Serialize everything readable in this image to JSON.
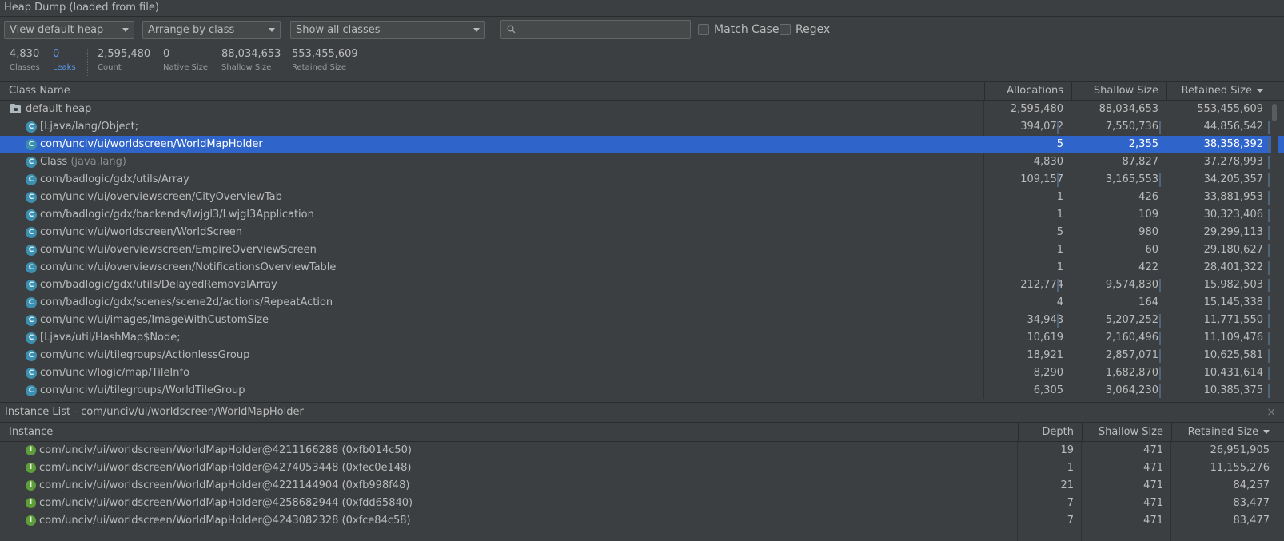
{
  "title": "Heap Dump (loaded from file)",
  "toolbar": {
    "heap_select": "View default heap",
    "arrange_select": "Arrange by class",
    "filter_select": "Show all classes",
    "search_value": "",
    "match_case_label": "Match Case",
    "regex_label": "Regex"
  },
  "stats": [
    {
      "value": "4,830",
      "label": "Classes"
    },
    {
      "value": "0",
      "label": "Leaks"
    },
    {
      "value": "2,595,480",
      "label": "Count"
    },
    {
      "value": "0",
      "label": "Native Size"
    },
    {
      "value": "88,034,653",
      "label": "Shallow Size"
    },
    {
      "value": "553,455,609",
      "label": "Retained Size"
    }
  ],
  "class_table": {
    "columns": [
      "Class Name",
      "Allocations",
      "Shallow Size",
      "Retained Size"
    ],
    "root": {
      "name": "default heap",
      "allocations": "2,595,480",
      "shallow": "88,034,653",
      "retained": "553,455,609"
    },
    "rows": [
      {
        "name": "[Ljava/lang/Object;",
        "suffix": "",
        "allocations": "394,072",
        "shallow": "7,550,736",
        "retained": "44,856,542"
      },
      {
        "name": "com/unciv/ui/worldscreen/WorldMapHolder",
        "suffix": "",
        "allocations": "5",
        "shallow": "2,355",
        "retained": "38,358,392"
      },
      {
        "name": "Class",
        "suffix": "(java.lang)",
        "allocations": "4,830",
        "shallow": "87,827",
        "retained": "37,278,993"
      },
      {
        "name": "com/badlogic/gdx/utils/Array",
        "suffix": "",
        "allocations": "109,157",
        "shallow": "3,165,553",
        "retained": "34,205,357"
      },
      {
        "name": "com/unciv/ui/overviewscreen/CityOverviewTab",
        "suffix": "",
        "allocations": "1",
        "shallow": "426",
        "retained": "33,881,953"
      },
      {
        "name": "com/badlogic/gdx/backends/lwjgl3/Lwjgl3Application",
        "suffix": "",
        "allocations": "1",
        "shallow": "109",
        "retained": "30,323,406"
      },
      {
        "name": "com/unciv/ui/worldscreen/WorldScreen",
        "suffix": "",
        "allocations": "5",
        "shallow": "980",
        "retained": "29,299,113"
      },
      {
        "name": "com/unciv/ui/overviewscreen/EmpireOverviewScreen",
        "suffix": "",
        "allocations": "1",
        "shallow": "60",
        "retained": "29,180,627"
      },
      {
        "name": "com/unciv/ui/overviewscreen/NotificationsOverviewTable",
        "suffix": "",
        "allocations": "1",
        "shallow": "422",
        "retained": "28,401,322"
      },
      {
        "name": "com/badlogic/gdx/utils/DelayedRemovalArray",
        "suffix": "",
        "allocations": "212,774",
        "shallow": "9,574,830",
        "retained": "15,982,503"
      },
      {
        "name": "com/badlogic/gdx/scenes/scene2d/actions/RepeatAction",
        "suffix": "",
        "allocations": "4",
        "shallow": "164",
        "retained": "15,145,338"
      },
      {
        "name": "com/unciv/ui/images/ImageWithCustomSize",
        "suffix": "",
        "allocations": "34,948",
        "shallow": "5,207,252",
        "retained": "11,771,550"
      },
      {
        "name": "[Ljava/util/HashMap$Node;",
        "suffix": "",
        "allocations": "10,619",
        "shallow": "2,160,496",
        "retained": "11,109,476"
      },
      {
        "name": "com/unciv/ui/tilegroups/ActionlessGroup",
        "suffix": "",
        "allocations": "18,921",
        "shallow": "2,857,071",
        "retained": "10,625,581"
      },
      {
        "name": "com/unciv/logic/map/TileInfo",
        "suffix": "",
        "allocations": "8,290",
        "shallow": "1,682,870",
        "retained": "10,431,614"
      },
      {
        "name": "com/unciv/ui/tilegroups/WorldTileGroup",
        "suffix": "",
        "allocations": "6,305",
        "shallow": "3,064,230",
        "retained": "10,385,375"
      }
    ],
    "selected_index": 1
  },
  "instance_panel": {
    "title": "Instance List - com/unciv/ui/worldscreen/WorldMapHolder",
    "columns": [
      "Instance",
      "Depth",
      "Shallow Size",
      "Retained Size"
    ],
    "rows": [
      {
        "name": "com/unciv/ui/worldscreen/WorldMapHolder@4211166288 (0xfb014c50)",
        "depth": "19",
        "shallow": "471",
        "retained": "26,951,905"
      },
      {
        "name": "com/unciv/ui/worldscreen/WorldMapHolder@4274053448 (0xfec0e148)",
        "depth": "1",
        "shallow": "471",
        "retained": "11,155,276"
      },
      {
        "name": "com/unciv/ui/worldscreen/WorldMapHolder@4221144904 (0xfb998f48)",
        "depth": "21",
        "shallow": "471",
        "retained": "84,257"
      },
      {
        "name": "com/unciv/ui/worldscreen/WorldMapHolder@4258682944 (0xfdd65840)",
        "depth": "7",
        "shallow": "471",
        "retained": "83,477"
      },
      {
        "name": "com/unciv/ui/worldscreen/WorldMapHolder@4243082328 (0xfce84c58)",
        "depth": "7",
        "shallow": "471",
        "retained": "83,477"
      }
    ]
  },
  "icons": {
    "class_glyph": "C",
    "instance_glyph": "I",
    "close_glyph": "×"
  },
  "colors": {
    "selection": "#2f65ca",
    "leaks_accent": "#589df6",
    "class_icon": "#3d8fb0",
    "instance_icon": "#5e9e3a"
  }
}
